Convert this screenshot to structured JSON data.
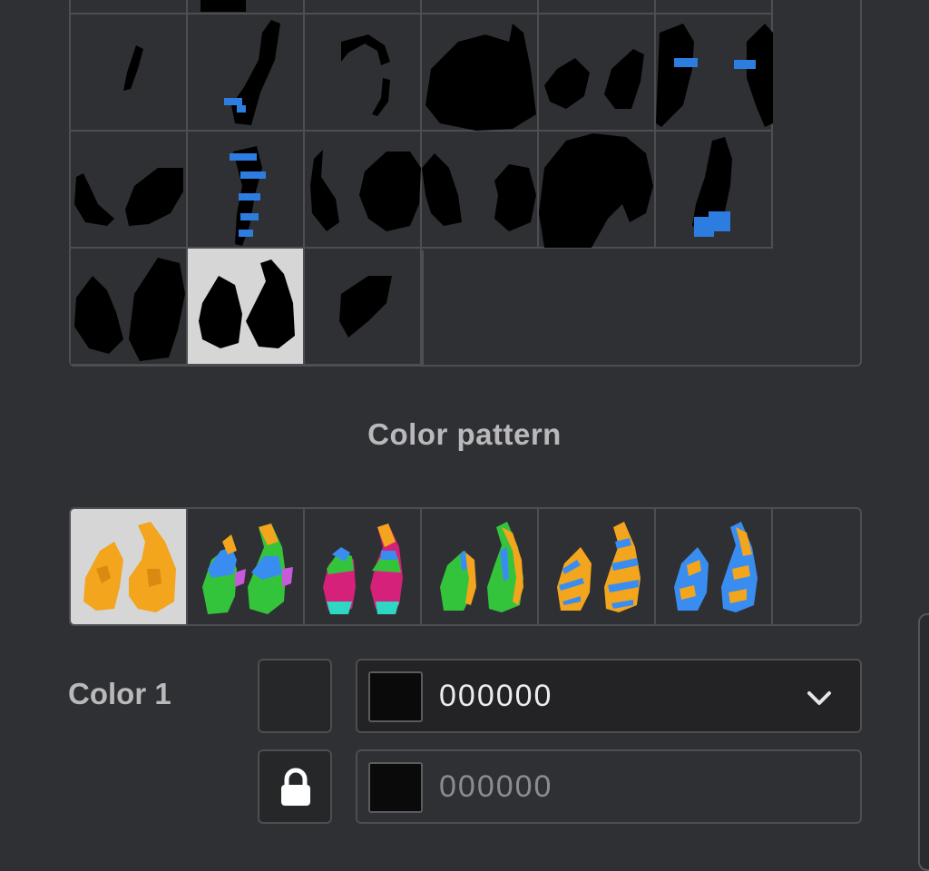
{
  "shapes_grid": {
    "rows": 4,
    "columns": 6,
    "selected_index": 19,
    "item_count": 21
  },
  "color_pattern": {
    "title": "Color pattern",
    "selected_index": 0,
    "options": [
      {
        "name": "solid",
        "colors": [
          "#f2a51d"
        ]
      },
      {
        "name": "blue-green-purple",
        "colors": [
          "#f2a51d",
          "#3a8df0",
          "#34c43c",
          "#c65ad8"
        ]
      },
      {
        "name": "blue-green-magenta",
        "colors": [
          "#f2a51d",
          "#3a8df0",
          "#34c43c",
          "#d6217a",
          "#2fd6c4"
        ]
      },
      {
        "name": "green-orange",
        "colors": [
          "#f2a51d",
          "#34c43c",
          "#3a8df0"
        ]
      },
      {
        "name": "orange-blue-stripes",
        "colors": [
          "#f2a51d",
          "#3a8df0"
        ]
      },
      {
        "name": "blue-orange",
        "colors": [
          "#3a8df0",
          "#f2a51d"
        ]
      }
    ]
  },
  "color1": {
    "label": "Color 1",
    "hex_value": "000000",
    "hex_placeholder": "000000",
    "swatch_color": "#000000",
    "chevron_icon": "chevron-down-icon",
    "lock_icon": "lock-icon"
  }
}
